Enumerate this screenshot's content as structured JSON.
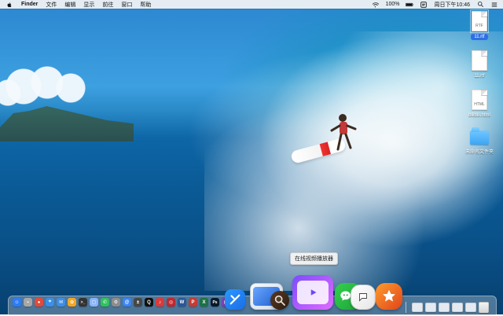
{
  "menubar": {
    "app_name": "Finder",
    "items": [
      "文件",
      "编辑",
      "显示",
      "前往",
      "窗口",
      "帮助"
    ],
    "status": {
      "battery_percent": "100%",
      "clock": "周日下午10:46"
    },
    "icons": [
      "apple-icon",
      "wifi-icon",
      "battery-icon",
      "notification-icon",
      "spotlight-icon",
      "menu-extra-icon"
    ]
  },
  "desktop_items": [
    {
      "name": "11.rtf",
      "kind": "file",
      "mini": "RTF",
      "selected": true
    },
    {
      "name": "11.rtf",
      "kind": "file",
      "mini": "",
      "selected": false
    },
    {
      "name": "bilibili.html",
      "kind": "file",
      "mini": "HTML",
      "selected": false
    },
    {
      "name": "未命名文件夹",
      "kind": "folder",
      "selected": false
    }
  ],
  "dock": {
    "tooltip": "在线视频播放器",
    "small_icons": [
      {
        "name": "finder-icon",
        "color": "#2c7cf6",
        "glyph": "☺"
      },
      {
        "name": "launchpad-icon",
        "color": "#a7a7a7",
        "glyph": "⌁"
      },
      {
        "name": "chrome-icon",
        "color": "#e24a3a",
        "glyph": "●"
      },
      {
        "name": "safari-icon",
        "color": "#3c8ee8",
        "glyph": "⌖"
      },
      {
        "name": "mail-icon",
        "color": "#3e8ee6",
        "glyph": "✉"
      },
      {
        "name": "photos-icon",
        "color": "#f5a623",
        "glyph": "✿"
      },
      {
        "name": "terminal-icon",
        "color": "#333333",
        "glyph": ">_"
      },
      {
        "name": "preview-icon",
        "color": "#8ab4f8",
        "glyph": "▢"
      },
      {
        "name": "messages-icon",
        "color": "#31c25b",
        "glyph": "✆"
      },
      {
        "name": "settings-icon",
        "color": "#8d8d8d",
        "glyph": "⚙"
      },
      {
        "name": "mail-app-icon",
        "color": "#3b84f2",
        "glyph": "@"
      },
      {
        "name": "calculator-icon",
        "color": "#474747",
        "glyph": "±"
      },
      {
        "name": "qq-icon",
        "color": "#0f0f0f",
        "glyph": "Q"
      },
      {
        "name": "music-icon",
        "color": "#d93b3b",
        "glyph": "♪"
      },
      {
        "name": "netease-icon",
        "color": "#c1272d",
        "glyph": "◎"
      },
      {
        "name": "word-icon",
        "color": "#2b5797",
        "glyph": "W"
      },
      {
        "name": "pdf-icon",
        "color": "#c63b33",
        "glyph": "P"
      },
      {
        "name": "excel-icon",
        "color": "#1e7145",
        "glyph": "X"
      },
      {
        "name": "ps-icon",
        "color": "#071a2a",
        "glyph": "Ps"
      },
      {
        "name": "player-icon",
        "color": "#7e3fbf",
        "glyph": "▶"
      }
    ],
    "big_icons": [
      {
        "name": "xcode-icon",
        "color": "#1d7cf2"
      },
      {
        "name": "preview-large-icon",
        "color": "#dfe7f2"
      },
      {
        "name": "magnifier-icon",
        "color": "#3b2b1f"
      },
      {
        "name": "online-video-player-icon",
        "color": "#a86be8"
      },
      {
        "name": "wechat-icon",
        "color": "#2bbf3a"
      },
      {
        "name": "chat-bubble-icon",
        "color": "#ffffff"
      },
      {
        "name": "star-app-icon",
        "color": "#f07a1a"
      }
    ],
    "right_items": [
      "downloads-stack",
      "documents-stack",
      "desktop-stack",
      "recent-stack",
      "apps-stack",
      "trash"
    ]
  }
}
